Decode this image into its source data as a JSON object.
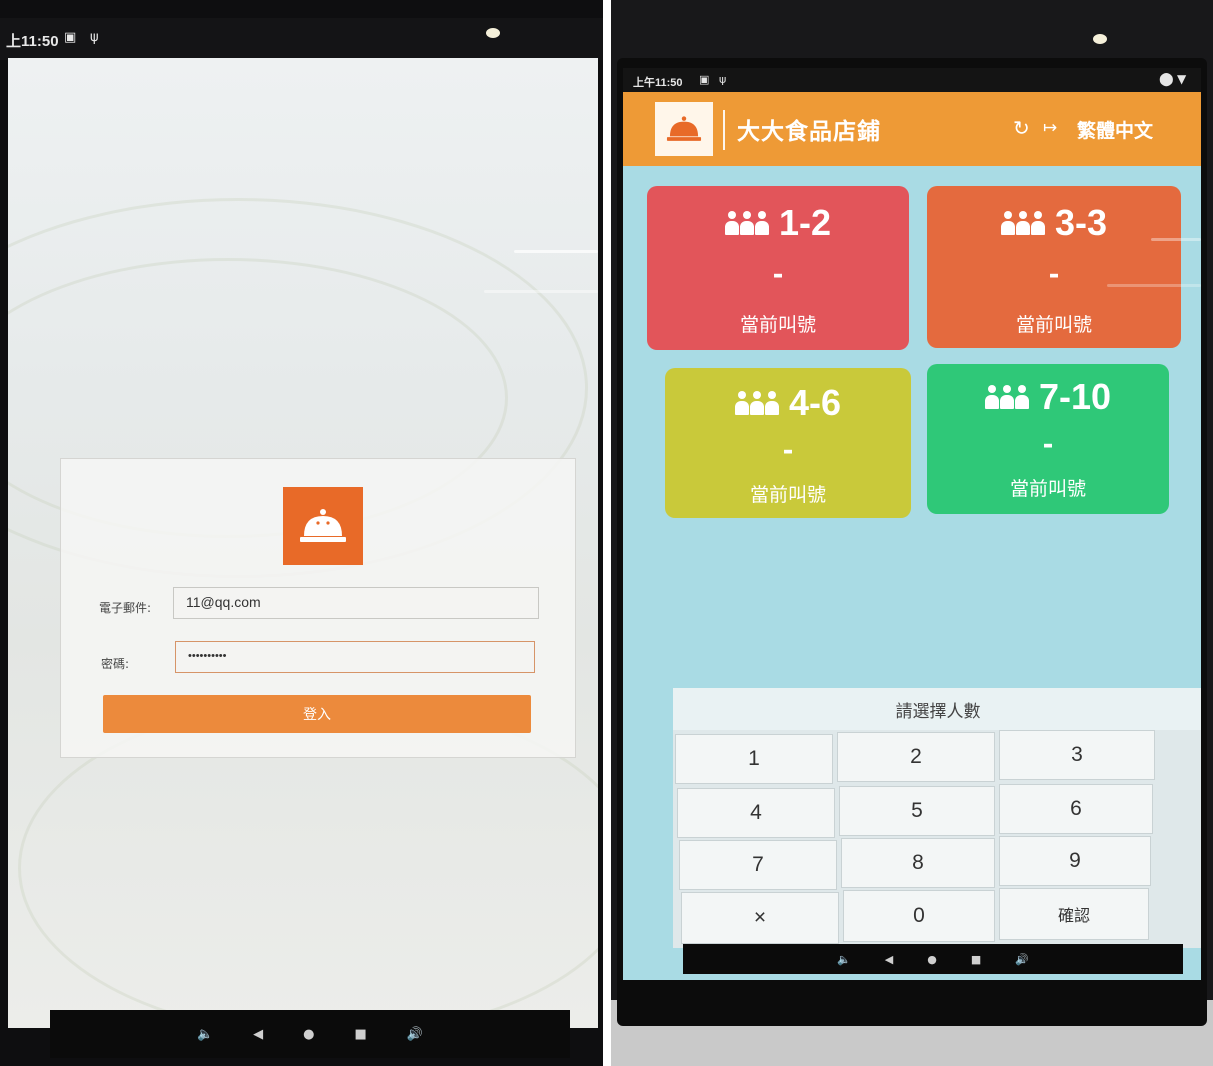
{
  "left_device": {
    "status_time": "上11:50",
    "status_icons": [
      "notification-icon",
      "usb-icon"
    ],
    "login": {
      "email_label": "電子郵件:",
      "email_value": "11@qq.com",
      "password_label": "密碼:",
      "password_value": "••••••••••",
      "login_button": "登入"
    },
    "nav_icons": [
      "volume-down-icon",
      "back-icon",
      "home-icon",
      "recents-icon",
      "volume-up-icon"
    ]
  },
  "right_device": {
    "status_time": "上午11:50",
    "header": {
      "store_name": "大大食品店鋪",
      "refresh_icon": "refresh-icon",
      "logout_icon": "logout-icon",
      "language": "繁體中文"
    },
    "queue_tiles": [
      {
        "range": "1-2",
        "current_number": "-",
        "label": "當前叫號",
        "color": "#e2555a"
      },
      {
        "range": "3-3",
        "current_number": "-",
        "label": "當前叫號",
        "color": "#e46a3e"
      },
      {
        "range": "4-6",
        "current_number": "-",
        "label": "當前叫號",
        "color": "#c9c93a"
      },
      {
        "range": "7-10",
        "current_number": "-",
        "label": "當前叫號",
        "color": "#2fc878"
      }
    ],
    "keypad": {
      "prompt": "請選擇人數",
      "keys": [
        "1",
        "2",
        "3",
        "4",
        "5",
        "6",
        "7",
        "8",
        "9",
        "×",
        "0",
        "確認"
      ]
    },
    "nav_icons": [
      "volume-down-icon",
      "back-icon",
      "home-icon",
      "recents-icon",
      "volume-up-icon"
    ]
  }
}
